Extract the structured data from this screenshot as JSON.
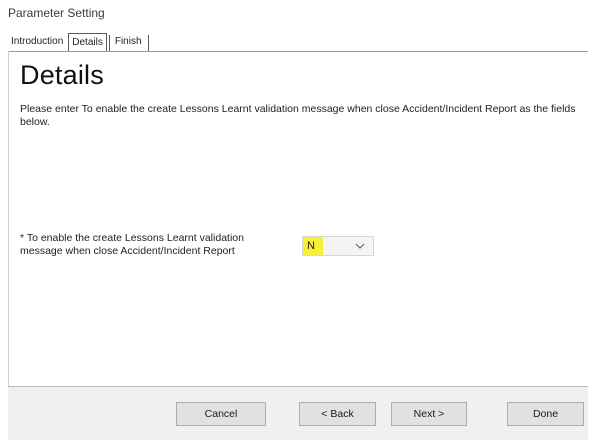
{
  "window": {
    "title": "Parameter Setting"
  },
  "tabs": [
    {
      "label": "Introduction",
      "active": false
    },
    {
      "label": "Details",
      "active": true
    },
    {
      "label": "Finish",
      "active": false
    }
  ],
  "page": {
    "heading": "Details",
    "description": "Please enter To enable the create Lessons Learnt validation message when close Accident/Incident Report as the fields below."
  },
  "field": {
    "label": "* To enable the create Lessons Learnt validation message when close Accident/Incident Report",
    "value": "N",
    "highlight_color": "#f6f03a"
  },
  "buttons": {
    "cancel": "Cancel",
    "back": "< Back",
    "next": "Next >",
    "done": "Done"
  }
}
